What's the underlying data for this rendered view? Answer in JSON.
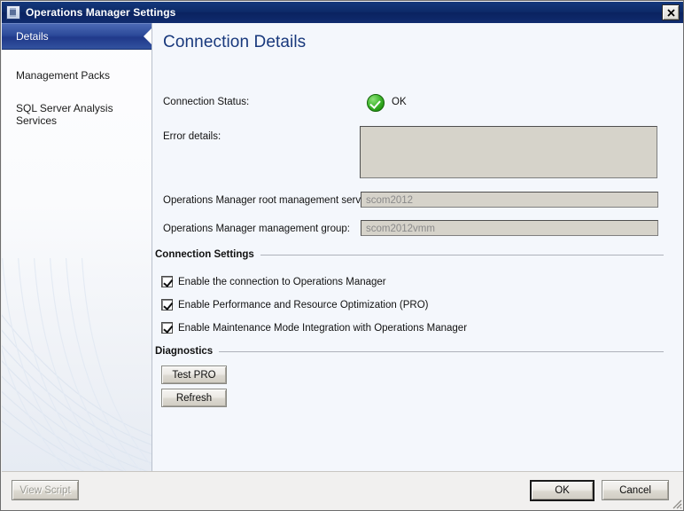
{
  "window": {
    "title": "Operations Manager Settings",
    "icon": "window-settings-icon",
    "close_label": "✕"
  },
  "sidebar": {
    "items": [
      {
        "label": "Details",
        "selected": true
      },
      {
        "label": "Management Packs",
        "selected": false
      },
      {
        "label": "SQL Server Analysis Services",
        "selected": false
      }
    ]
  },
  "main": {
    "page_title": "Connection Details",
    "connection_status": {
      "label": "Connection Status:",
      "icon": "status-ok-icon",
      "value": "OK"
    },
    "error_details": {
      "label": "Error details:",
      "value": "",
      "enabled": false
    },
    "root_management_server": {
      "label": "Operations Manager root management server:",
      "value": "scom2012",
      "enabled": false
    },
    "management_group": {
      "label": "Operations Manager management group:",
      "value": "scom2012vmm",
      "enabled": false
    },
    "connection_settings": {
      "title": "Connection Settings",
      "checkboxes": [
        {
          "label": "Enable the connection to Operations Manager",
          "checked": true
        },
        {
          "label": "Enable Performance and Resource Optimization (PRO)",
          "checked": true
        },
        {
          "label": "Enable Maintenance Mode Integration with Operations Manager",
          "checked": true
        }
      ]
    },
    "diagnostics": {
      "title": "Diagnostics",
      "test_pro_label": "Test PRO",
      "refresh_label": "Refresh"
    }
  },
  "footer": {
    "view_script_label": "View Script",
    "view_script_enabled": false,
    "ok_label": "OK",
    "cancel_label": "Cancel",
    "resize_grip": "resize-grip-icon"
  },
  "colors": {
    "titlebar": "#0d2a68",
    "accent_heading": "#18387c",
    "selected_item": "#2c4a9a",
    "status_ok": "#229411",
    "content_bg": "#f4f7fc",
    "field_disabled_bg": "#d6d3ca"
  }
}
